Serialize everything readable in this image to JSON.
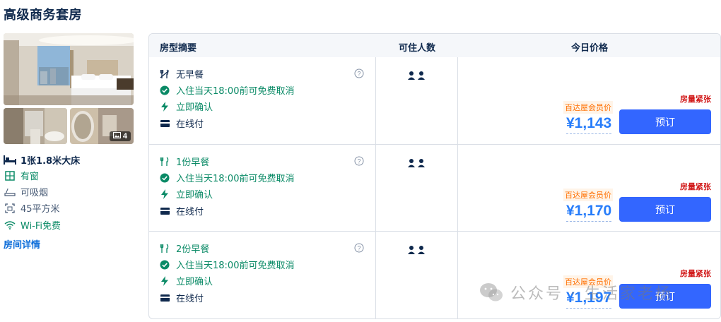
{
  "room": {
    "title": "高级商务套房",
    "photo_count": "4",
    "bed": "1张1.8米大床",
    "window": "有窗",
    "smoking": "可吸烟",
    "area": "45平方米",
    "wifi": "Wi-Fi免费",
    "details_link": "房间详情"
  },
  "table": {
    "headers": {
      "summary": "房型摘要",
      "guests": "可住人数",
      "price": "今日价格"
    },
    "rows": [
      {
        "meal": "无早餐",
        "cancel": "入住当天18:00前可免费取消",
        "confirm": "立即确认",
        "payment": "在线付",
        "scarce": "房量紧张",
        "member_tag": "百达屋会员价",
        "price": "¥1,143",
        "book": "预订"
      },
      {
        "meal": "1份早餐",
        "cancel": "入住当天18:00前可免费取消",
        "confirm": "立即确认",
        "payment": "在线付",
        "scarce": "房量紧张",
        "member_tag": "百达屋会员价",
        "price": "¥1,170",
        "book": "预订"
      },
      {
        "meal": "2份早餐",
        "cancel": "入住当天18:00前可免费取消",
        "confirm": "立即确认",
        "payment": "在线付",
        "scarce": "房量紧张",
        "member_tag": "百达屋会员价",
        "price": "¥1,197",
        "book": "预订"
      }
    ]
  },
  "watermark": {
    "text": "公众号 · 生活家老杨"
  },
  "colors": {
    "green": "#0a8a66",
    "price_blue": "#287dfa",
    "button_blue": "#3366ff",
    "scarce_red": "#d21d1d",
    "member_orange": "#ff6f00"
  },
  "icons": {
    "no_breakfast": "fork-knife-crossed-icon",
    "breakfast": "fork-knife-icon",
    "cancel": "check-circle-icon",
    "confirm": "lightning-icon",
    "pay": "card-icon",
    "help": "question-circle-icon",
    "guests": "two-person-icon"
  }
}
